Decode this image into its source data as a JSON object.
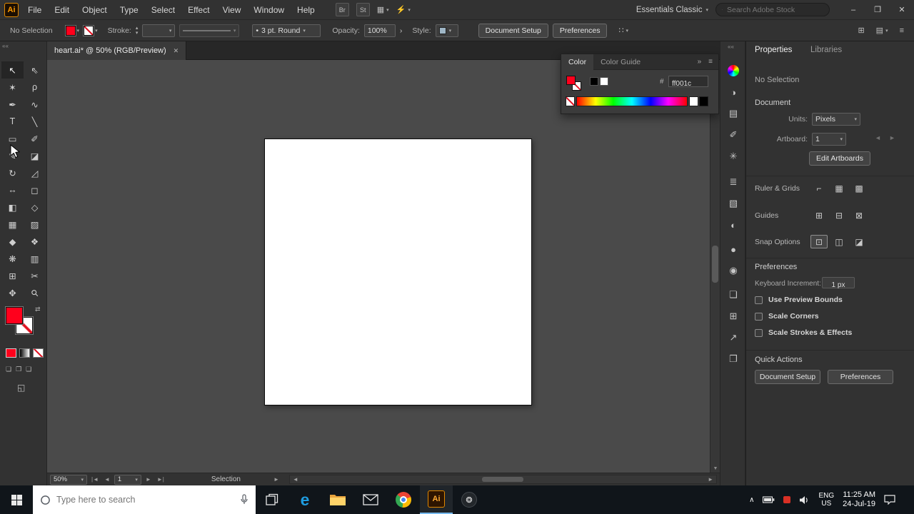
{
  "colors": {
    "fill_red": "#ff001c",
    "ai_orange": "#ff9a00",
    "accent_blue": "#76b9ed"
  },
  "menu_bar": {
    "logo": "Ai",
    "menus": [
      "File",
      "Edit",
      "Object",
      "Type",
      "Select",
      "Effect",
      "View",
      "Window",
      "Help"
    ],
    "bridge_badge": "Br",
    "stock_badge": "St",
    "workspace": "Essentials Classic",
    "stock_search_placeholder": "Search Adobe Stock"
  },
  "window_controls": {
    "minimize": "–",
    "restore": "❐",
    "close": "✕"
  },
  "control_bar": {
    "selection_status": "No Selection",
    "stroke_label": "Stroke:",
    "brush_name": "3 pt. Round",
    "opacity_label": "Opacity:",
    "opacity_value": "100%",
    "style_label": "Style:",
    "document_setup_label": "Document Setup",
    "preferences_label": "Preferences"
  },
  "document": {
    "tab_title": "heart.ai* @ 50% (RGB/Preview)",
    "zoom_value": "50%",
    "artboard_number": "1",
    "status_text": "Selection"
  },
  "color_panel": {
    "tab_color": "Color",
    "tab_color_guide": "Color Guide",
    "hex_symbol": "#",
    "hex_value": "ff001c"
  },
  "properties": {
    "tab_properties": "Properties",
    "tab_libraries": "Libraries",
    "selection_status": "No Selection",
    "section_document": "Document",
    "units_label": "Units:",
    "units_value": "Pixels",
    "artboard_label": "Artboard:",
    "artboard_value": "1",
    "edit_artboards_label": "Edit Artboards",
    "ruler_grids_label": "Ruler & Grids",
    "guides_label": "Guides",
    "snap_options_label": "Snap Options",
    "section_preferences": "Preferences",
    "keyboard_increment_label": "Keyboard Increment:",
    "keyboard_increment_value": "1 px",
    "checkboxes": [
      "Use Preview Bounds",
      "Scale Corners",
      "Scale Strokes & Effects"
    ],
    "section_quick_actions": "Quick Actions",
    "quick_document_setup": "Document Setup",
    "quick_preferences": "Preferences"
  },
  "taskbar": {
    "search_placeholder": "Type here to search",
    "ai_label": "Ai",
    "language": "ENG",
    "region": "US",
    "time": "11:25 AM",
    "date": "24-Jul-19"
  },
  "tools": {
    "selection": "↖",
    "direct_selection": "⇖",
    "magic_wand": "✶",
    "lasso": "ρ",
    "pen": "✒",
    "curvature": "∿",
    "type": "T",
    "line": "╲",
    "rectangle": "▭",
    "paintbrush": "✐",
    "shaper": "✎",
    "eraser": "◪",
    "rotate": "↻",
    "scale": "◿",
    "width": "↔",
    "free_transform": "◻",
    "shape_builder": "◧",
    "perspective_grid": "◇",
    "mesh": "▦",
    "gradient": "▨",
    "eyedropper": "◆",
    "blend": "❖",
    "symbol_sprayer": "❋",
    "column_graph": "▥",
    "artboard": "⊞",
    "slice": "✂",
    "hand": "✥",
    "zoom": "⚲"
  },
  "dock_icons": {
    "color_guide": "◑",
    "swatches": "▤",
    "brushes": "✐",
    "symbols": "✳",
    "stroke": "≣",
    "gradient": "▧",
    "transparency": "◐",
    "appearance": "●",
    "graphic_styles": "◉",
    "layers": "❏",
    "artboards": "⊞",
    "asset_export": "↗",
    "libraries": "❐"
  },
  "pp_icons": {
    "ruler_grids": [
      "⌐",
      "▦",
      "▩"
    ],
    "guides": [
      "⊞",
      "⊟",
      "⊠"
    ],
    "snap": [
      "⊡",
      "◫",
      "◪"
    ]
  },
  "glyphs": {
    "caret_down": "▾",
    "caret_up": "▴",
    "chevron_right_small": "›",
    "collapse_left": "««",
    "collapse_right": "»»",
    "double_right": "»",
    "menu": "≡",
    "grid": "⊞",
    "panel": "▤",
    "close": "✕",
    "dot": "•",
    "swap": "⇄",
    "arrange": "▦",
    "gpu": "⚡",
    "align": "∷",
    "nav_first": "|◄",
    "nav_prev": "◄",
    "nav_next": "►",
    "nav_last": "►|",
    "scroll_up": "▲",
    "scroll_down": "▼",
    "scroll_left": "◄",
    "scroll_right": "►",
    "draw_normal": "❏",
    "draw_behind": "❐",
    "draw_inside": "❑",
    "screen_mode": "◱",
    "tray_up": "∧",
    "obs": "❂",
    "edge": "e",
    "expand_right": "►"
  }
}
